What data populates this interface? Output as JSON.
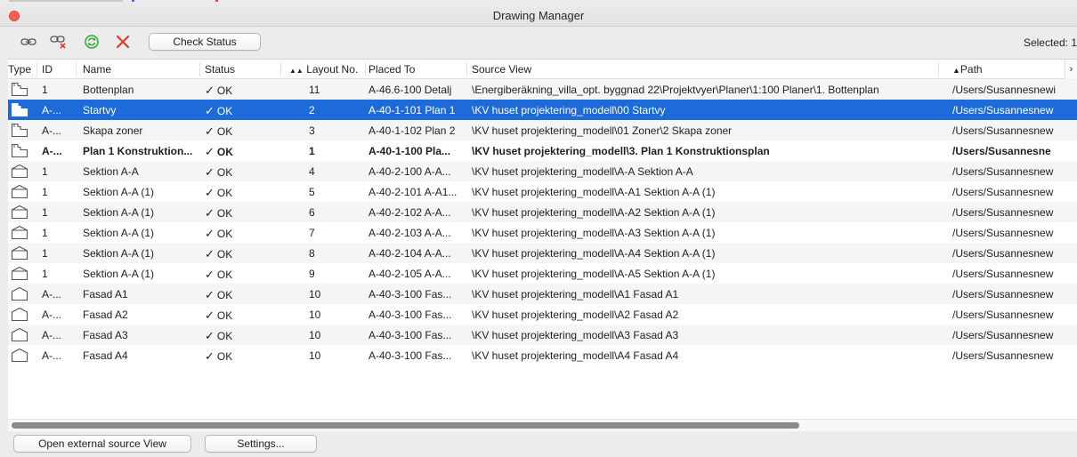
{
  "window": {
    "title": "Drawing Manager",
    "close_color": "#fd5f57"
  },
  "toolbar": {
    "icons": [
      "link-drawing-icon",
      "unlink-drawing-icon",
      "update-icon",
      "delete-icon"
    ],
    "check_status_label": "Check Status",
    "selected_text": "Selected: 1"
  },
  "table": {
    "columns": {
      "type": "Type",
      "id": "ID",
      "name": "Name",
      "status": "Status",
      "layout_no": "Layout No.",
      "layout_sort_mark": "▲▲",
      "placed_to": "Placed To",
      "source_view": "Source View",
      "path": "Path",
      "path_sort_mark": "▲"
    },
    "scroll_arrow": "›",
    "rows": [
      {
        "type_icon": "floorplan-icon",
        "id": "1",
        "name": "Bottenplan",
        "status_check": "✓",
        "status": "OK",
        "layout_no": "11",
        "placed_to": "A-46.6-100 Detalj",
        "source_view": "\\Energiberäkning_villa_opt. byggnad 22\\Projektvyer\\Planer\\1:100 Planer\\1. Bottenplan",
        "path": "/Users/Susannesnewi"
      },
      {
        "type_icon": "floorplan-icon",
        "id": "A-...",
        "name": "Startvy",
        "status_check": "✓",
        "status": "OK",
        "layout_no": "2",
        "placed_to": "A-40-1-101 Plan 1",
        "source_view": "\\KV huset projektering_modell\\00 Startvy",
        "path": "/Users/Susannesnew"
      },
      {
        "type_icon": "floorplan-icon",
        "id": "A-...",
        "name": "Skapa zoner",
        "status_check": "✓",
        "status": "OK",
        "layout_no": "3",
        "placed_to": "A-40-1-102 Plan 2",
        "source_view": "\\KV huset projektering_modell\\01 Zoner\\2 Skapa zoner",
        "path": "/Users/Susannesnew"
      },
      {
        "type_icon": "floorplan-icon",
        "id": "A-...",
        "name": "Plan 1 Konstruktion...",
        "status_check": "✓",
        "status": "OK",
        "layout_no": "1",
        "placed_to": "A-40-1-100 Pla...",
        "source_view": "\\KV huset projektering_modell\\3. Plan 1 Konstruktionsplan",
        "path": "/Users/Susannesne"
      },
      {
        "type_icon": "section-icon",
        "id": "1",
        "name": "Sektion A-A",
        "status_check": "✓",
        "status": "OK",
        "layout_no": "4",
        "placed_to": "A-40-2-100 A-A...",
        "source_view": "\\KV huset projektering_modell\\A-A Sektion A-A",
        "path": "/Users/Susannesnew"
      },
      {
        "type_icon": "section-icon",
        "id": "1",
        "name": "Sektion A-A (1)",
        "status_check": "✓",
        "status": "OK",
        "layout_no": "5",
        "placed_to": "A-40-2-101 A-A1...",
        "source_view": "\\KV huset projektering_modell\\A-A1 Sektion A-A (1)",
        "path": "/Users/Susannesnew"
      },
      {
        "type_icon": "section-icon",
        "id": "1",
        "name": "Sektion A-A (1)",
        "status_check": "✓",
        "status": "OK",
        "layout_no": "6",
        "placed_to": "A-40-2-102 A-A...",
        "source_view": "\\KV huset projektering_modell\\A-A2 Sektion A-A (1)",
        "path": "/Users/Susannesnew"
      },
      {
        "type_icon": "section-icon",
        "id": "1",
        "name": "Sektion A-A (1)",
        "status_check": "✓",
        "status": "OK",
        "layout_no": "7",
        "placed_to": "A-40-2-103 A-A...",
        "source_view": "\\KV huset projektering_modell\\A-A3 Sektion A-A (1)",
        "path": "/Users/Susannesnew"
      },
      {
        "type_icon": "section-icon",
        "id": "1",
        "name": "Sektion A-A (1)",
        "status_check": "✓",
        "status": "OK",
        "layout_no": "8",
        "placed_to": "A-40-2-104 A-A...",
        "source_view": "\\KV huset projektering_modell\\A-A4 Sektion A-A (1)",
        "path": "/Users/Susannesnew"
      },
      {
        "type_icon": "section-icon",
        "id": "1",
        "name": "Sektion A-A (1)",
        "status_check": "✓",
        "status": "OK",
        "layout_no": "9",
        "placed_to": "A-40-2-105 A-A...",
        "source_view": "\\KV huset projektering_modell\\A-A5 Sektion A-A (1)",
        "path": "/Users/Susannesnew"
      },
      {
        "type_icon": "elevation-icon",
        "id": "A-...",
        "name": "Fasad A1",
        "status_check": "✓",
        "status": "OK",
        "layout_no": "10",
        "placed_to": "A-40-3-100 Fas...",
        "source_view": "\\KV huset projektering_modell\\A1 Fasad A1",
        "path": "/Users/Susannesnew"
      },
      {
        "type_icon": "elevation-icon",
        "id": "A-...",
        "name": "Fasad A2",
        "status_check": "✓",
        "status": "OK",
        "layout_no": "10",
        "placed_to": "A-40-3-100 Fas...",
        "source_view": "\\KV huset projektering_modell\\A2 Fasad A2",
        "path": "/Users/Susannesnew"
      },
      {
        "type_icon": "elevation-icon",
        "id": "A-...",
        "name": "Fasad A3",
        "status_check": "✓",
        "status": "OK",
        "layout_no": "10",
        "placed_to": "A-40-3-100 Fas...",
        "source_view": "\\KV huset projektering_modell\\A3 Fasad A3",
        "path": "/Users/Susannesnew"
      },
      {
        "type_icon": "elevation-icon",
        "id": "A-...",
        "name": "Fasad A4",
        "status_check": "✓",
        "status": "OK",
        "layout_no": "10",
        "placed_to": "A-40-3-100 Fas...",
        "source_view": "\\KV huset projektering_modell\\A4 Fasad A4",
        "path": "/Users/Susannesnew"
      }
    ],
    "selected_row_color": "#1d6ad9"
  },
  "footer": {
    "open_external_label": "Open external source View",
    "settings_label": "Settings..."
  }
}
